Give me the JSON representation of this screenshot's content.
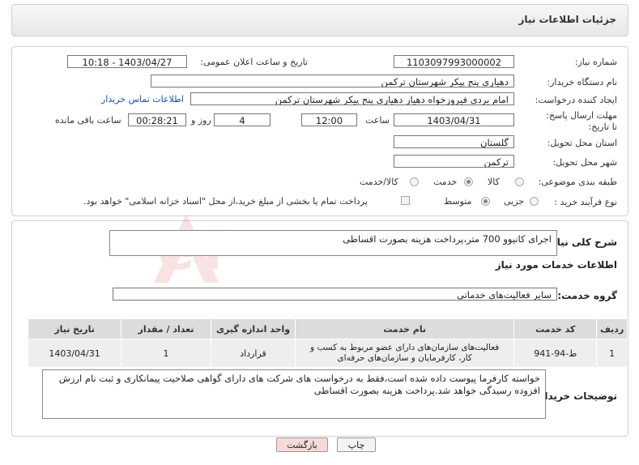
{
  "title": "جزئیات اطلاعات نیاز",
  "need_number": {
    "label": "شماره نیاز:",
    "value": "1103097993000002"
  },
  "announce": {
    "label": "تاریخ و ساعت اعلان عمومی:",
    "value": "1403/04/27 - 10:18"
  },
  "buyer": {
    "label": "نام دستگاه خریدار:",
    "value": "دهیاری پنج پیکر شهرستان ترکمن"
  },
  "creator": {
    "label": "ایجاد کننده درخواست:",
    "value": "امام بردی فیروزخواه دهیار دهیاری پنج پیکر شهرستان ترکمن",
    "contact_link": "اطلاعات تماس خریدار"
  },
  "deadline": {
    "label": "مهلت ارسال پاسخ: تا تاریخ:",
    "date": "1403/04/31",
    "time_label": "ساعت",
    "time": "12:00",
    "days": "4",
    "days_label": "روز و",
    "remaining": "00:28:21",
    "remaining_label": "ساعت باقی مانده"
  },
  "province": {
    "label": "استان محل تحویل:",
    "value": "گلستان"
  },
  "city": {
    "label": "شهر محل تحویل:",
    "value": "ترکمن"
  },
  "category": {
    "label": "طبقه بندی موضوعی:",
    "options": [
      "کالا",
      "خدمت",
      "کالا/خدمت"
    ],
    "selected": "خدمت"
  },
  "process": {
    "label": "نوع فرآیند خرید :",
    "options": [
      "جزیی",
      "متوسط"
    ],
    "selected": "متوسط",
    "treasury_note": "پرداخت تمام یا بخشی از مبلغ خرید،از محل \"اسناد خزانه اسلامی\" خواهد بود."
  },
  "description": {
    "label": "شرح کلی نیاز:",
    "value": "اجرای کانیوو 700 متر،پرداخت هزینه بصورت اقساطی"
  },
  "services_title": "اطلاعات خدمات مورد نیاز",
  "service_group": {
    "label": "گروه خدمت:",
    "value": "سایر فعالیت‌های خدماتی"
  },
  "table": {
    "headers": [
      "ردیف",
      "کد خدمت",
      "نام خدمت",
      "واحد اندازه گیری",
      "تعداد / مقدار",
      "تاریخ نیاز"
    ],
    "rows": [
      [
        "1",
        "ط-94-941",
        "فعالیت‌های سازمان‌های دارای عضو مربوط به کسب و کار، کارفرمایان و سازمان‌های حرفه‌ای",
        "قرارداد",
        "1",
        "1403/04/31"
      ]
    ]
  },
  "buyer_notes": {
    "label": "توضیحات خریدار:",
    "value": "خواسته کارفرما پیوست داده شده است،فقط به درخواست های شرکت های دارای گواهی صلاحیت پیمانکاری و ثبت نام ارزش افزوده رسیدگی خواهد شد.پرداخت هزینه بصورت اقساطی"
  },
  "buttons": {
    "print": "چاپ",
    "back": "بازگشت"
  },
  "colors": {
    "back_button_bg": "#f7d9d9",
    "link": "#1a4fb0",
    "watermark": "#cc2a2a"
  }
}
